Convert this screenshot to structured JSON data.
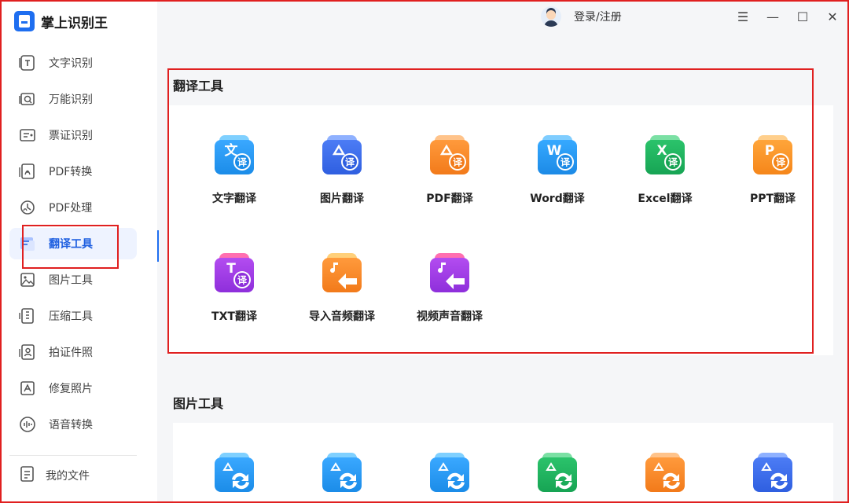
{
  "app": {
    "title": "掌上识别王"
  },
  "header": {
    "login_label": "登录/注册",
    "controls": [
      "☰",
      "—",
      "☐",
      "✕"
    ]
  },
  "sidebar": {
    "items": [
      {
        "label": "文字识别",
        "icon": "text-recognition-icon"
      },
      {
        "label": "万能识别",
        "icon": "universal-recognition-icon"
      },
      {
        "label": "票证识别",
        "icon": "ticket-recognition-icon"
      },
      {
        "label": "PDF转换",
        "icon": "pdf-convert-icon"
      },
      {
        "label": "PDF处理",
        "icon": "pdf-process-icon"
      },
      {
        "label": "翻译工具",
        "icon": "translate-icon",
        "active": true
      },
      {
        "label": "图片工具",
        "icon": "image-tools-icon"
      },
      {
        "label": "压缩工具",
        "icon": "compress-icon"
      },
      {
        "label": "拍证件照",
        "icon": "id-photo-icon"
      },
      {
        "label": "修复照片",
        "icon": "photo-repair-icon"
      },
      {
        "label": "语音转换",
        "icon": "voice-convert-icon"
      }
    ],
    "files_label": "我的文件"
  },
  "sections": {
    "translate": {
      "title": "翻译工具",
      "tools": [
        {
          "label": "文字翻译",
          "letter": "文",
          "badge": "译",
          "color1": "#3aa8ff",
          "color2": "#1b8ce8",
          "back": "#7fd0ff"
        },
        {
          "label": "图片翻译",
          "letter": "",
          "badge": "译",
          "color1": "#4c7cf5",
          "color2": "#2f5fe0",
          "back": "#8fb1ff"
        },
        {
          "label": "PDF翻译",
          "letter": "",
          "badge": "译",
          "color1": "#ff9a3c",
          "color2": "#f27a1a",
          "back": "#ffc38a"
        },
        {
          "label": "Word翻译",
          "letter": "W",
          "badge": "译",
          "color1": "#36a9ff",
          "color2": "#1c8ae6",
          "back": "#7fcdff"
        },
        {
          "label": "Excel翻译",
          "letter": "X",
          "badge": "译",
          "color1": "#2bc36b",
          "color2": "#17a454",
          "back": "#7be0a4"
        },
        {
          "label": "PPT翻译",
          "letter": "P",
          "badge": "译",
          "color1": "#ffa53a",
          "color2": "#f5861a",
          "back": "#ffcf8c"
        },
        {
          "label": "TXT翻译",
          "letter": "T",
          "badge": "译",
          "color1": "#b34cf0",
          "color2": "#8e2fdb",
          "back": "#ff6fb0"
        },
        {
          "label": "导入音频翻译",
          "letter": "",
          "badge": "",
          "color1": "#ff9a3c",
          "color2": "#f27a1a",
          "back": "#ffd07a"
        },
        {
          "label": "视频声音翻译",
          "letter": "",
          "badge": "",
          "color1": "#b34cf0",
          "color2": "#8e2fdb",
          "back": "#ff6fb0"
        }
      ]
    },
    "image": {
      "title": "图片工具",
      "tools": [
        {
          "color1": "#3aa8ff",
          "color2": "#1b8ce8",
          "back": "#7fd0ff"
        },
        {
          "color1": "#3aa8ff",
          "color2": "#1b8ce8",
          "back": "#7fd0ff"
        },
        {
          "color1": "#3aa8ff",
          "color2": "#1b8ce8",
          "back": "#7fd0ff"
        },
        {
          "color1": "#2bc36b",
          "color2": "#17a454",
          "back": "#7be0a4"
        },
        {
          "color1": "#ff9a3c",
          "color2": "#f27a1a",
          "back": "#ffc38a"
        },
        {
          "color1": "#4c7cf5",
          "color2": "#2f5fe0",
          "back": "#8fb1ff"
        }
      ]
    }
  }
}
